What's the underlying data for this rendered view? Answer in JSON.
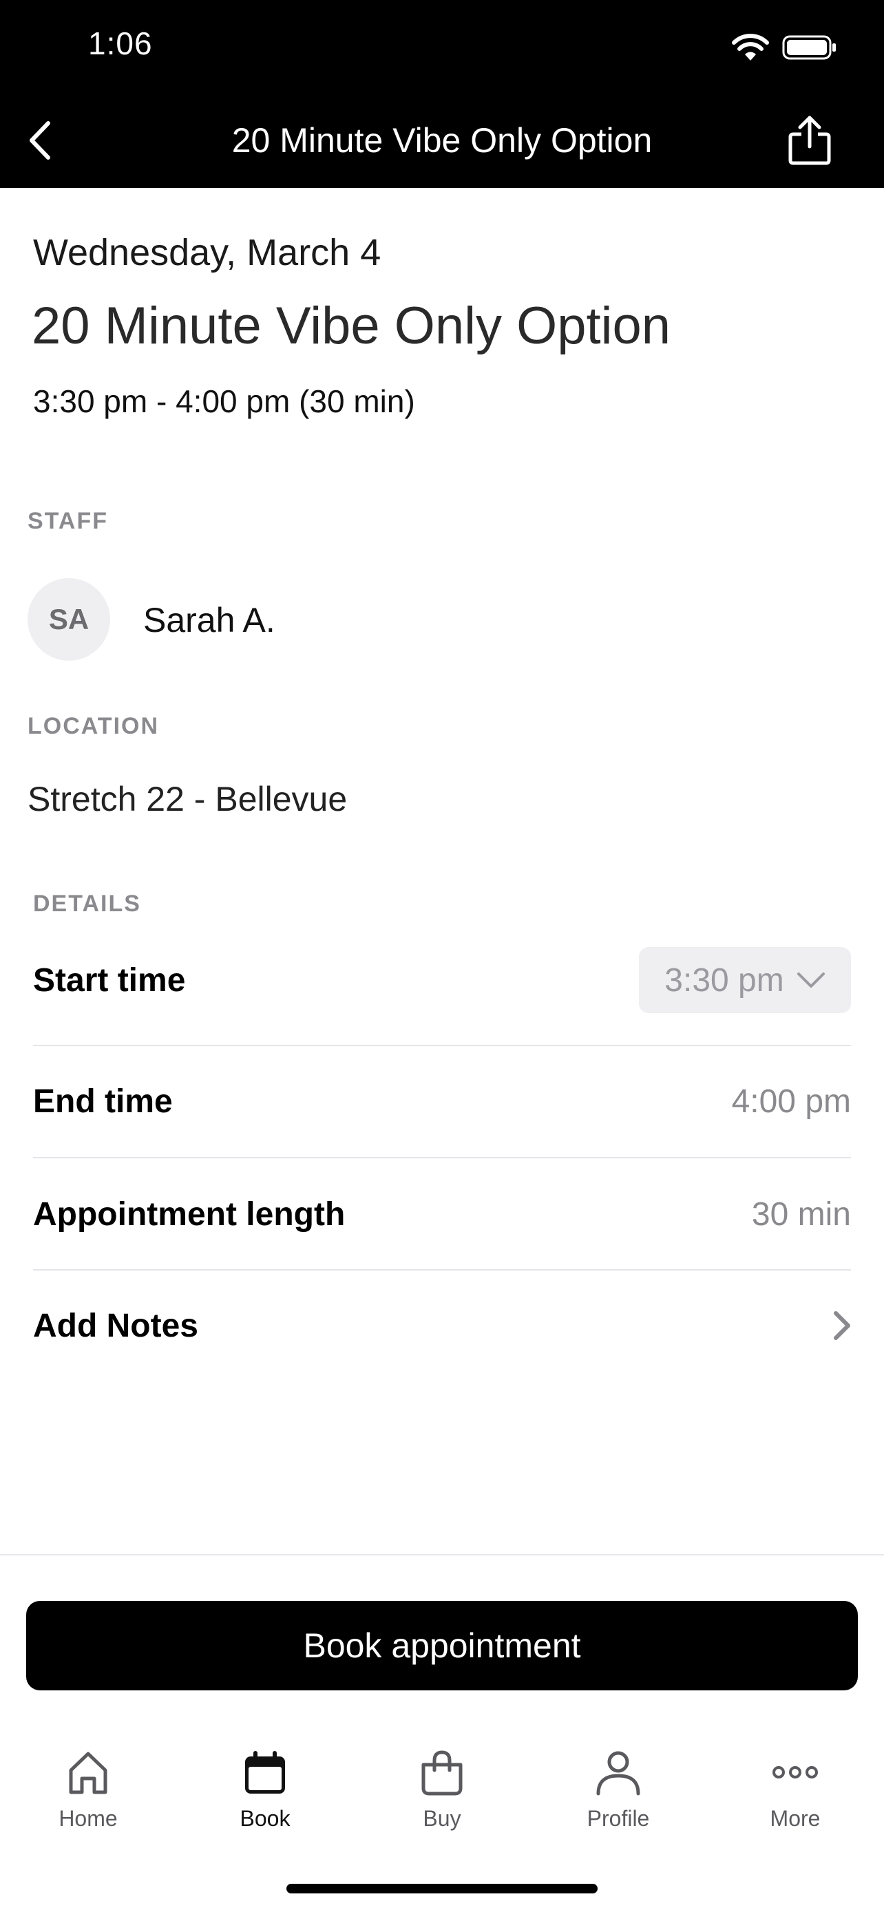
{
  "status_bar": {
    "time": "1:06"
  },
  "nav": {
    "title": "20 Minute Vibe Only Option"
  },
  "appointment": {
    "date": "Wednesday, March 4",
    "title": "20 Minute Vibe Only Option",
    "time_range": "3:30 pm - 4:00 pm (30 min)"
  },
  "staff": {
    "section_label": "STAFF",
    "initials": "SA",
    "name": "Sarah A."
  },
  "location": {
    "section_label": "LOCATION",
    "name": "Stretch 22 - Bellevue"
  },
  "details": {
    "section_label": "DETAILS",
    "start_time_label": "Start time",
    "start_time_value": "3:30 pm",
    "end_time_label": "End time",
    "end_time_value": "4:00 pm",
    "length_label": "Appointment length",
    "length_value": "30 min",
    "notes_label": "Add Notes"
  },
  "actions": {
    "book_label": "Book appointment"
  },
  "tabbar": {
    "active": "Book",
    "items": [
      {
        "label": "Home",
        "icon": "home-icon"
      },
      {
        "label": "Book",
        "icon": "calendar-icon"
      },
      {
        "label": "Buy",
        "icon": "bag-icon"
      },
      {
        "label": "Profile",
        "icon": "person-icon"
      },
      {
        "label": "More",
        "icon": "more-icon"
      }
    ]
  }
}
